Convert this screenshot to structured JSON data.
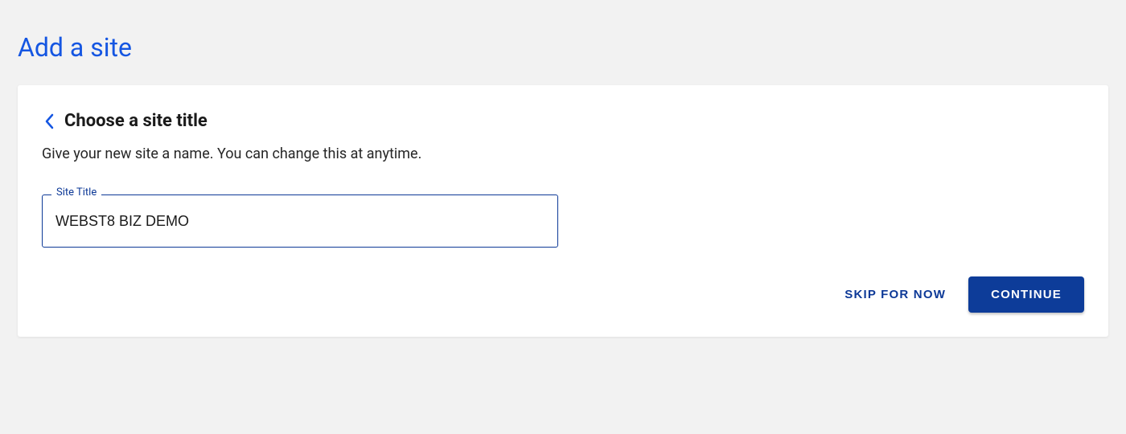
{
  "page": {
    "title": "Add a site"
  },
  "card": {
    "heading": "Choose a site title",
    "subtext": "Give your new site a name. You can change this at anytime.",
    "field": {
      "label": "Site Title",
      "value": "WEBST8 BIZ DEMO"
    },
    "buttons": {
      "skip": "SKIP FOR NOW",
      "continue": "CONTINUE"
    }
  }
}
